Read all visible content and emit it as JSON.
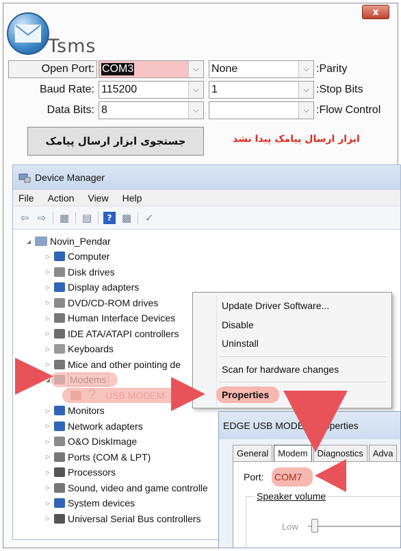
{
  "app": {
    "title": "Tsms",
    "close_glyph": "x"
  },
  "form": {
    "open_port_label": "Open Port:",
    "open_port_value": "COM3",
    "baud_rate_label": "Baud Rate:",
    "baud_rate_value": "115200",
    "data_bits_label": "Data Bits:",
    "data_bits_value": "8",
    "parity_label": ":Parity",
    "parity_value": "None",
    "stop_bits_label": ":Stop Bits",
    "stop_bits_value": "1",
    "flow_control_label": ":Flow Control",
    "flow_control_value": "",
    "search_button_label": "جستجوی ابزار ارسال پیامک",
    "status_text": "ابزار ارسال پیامک پیدا نشد"
  },
  "device_manager": {
    "title": "Device Manager",
    "menu": [
      "File",
      "Action",
      "View",
      "Help"
    ],
    "root": "Novin_Pendar",
    "tree": [
      {
        "label": "Computer",
        "icon": "computer-icon",
        "color": "#2f66b7"
      },
      {
        "label": "Disk drives",
        "icon": "disk-icon",
        "color": "#8a8a8a"
      },
      {
        "label": "Display adapters",
        "icon": "display-icon",
        "color": "#2f66b7"
      },
      {
        "label": "DVD/CD-ROM drives",
        "icon": "dvd-icon",
        "color": "#8a8a8a"
      },
      {
        "label": "Human Interface Devices",
        "icon": "hid-icon",
        "color": "#777777"
      },
      {
        "label": "IDE ATA/ATAPI controllers",
        "icon": "ide-icon",
        "color": "#6d6d6d"
      },
      {
        "label": "Keyboards",
        "icon": "keyboard-icon",
        "color": "#9a9a9a"
      },
      {
        "label": "Mice and other pointing de",
        "icon": "mouse-icon",
        "color": "#777777"
      },
      {
        "label": "Modems",
        "icon": "modem-icon",
        "color": "#6d7d95"
      },
      {
        "label": "USB MODEM",
        "icon": "unknown-device-icon",
        "color": "#b05050"
      },
      {
        "label": "Monitors",
        "icon": "monitor-icon",
        "color": "#2f66b7"
      },
      {
        "label": "Network adapters",
        "icon": "network-icon",
        "color": "#2f66b7"
      },
      {
        "label": "O&O DiskImage",
        "icon": "diskimage-icon",
        "color": "#8a8a8a"
      },
      {
        "label": "Ports (COM & LPT)",
        "icon": "ports-icon",
        "color": "#777777"
      },
      {
        "label": "Processors",
        "icon": "processor-icon",
        "color": "#555555"
      },
      {
        "label": "Sound, video and game controlle",
        "icon": "sound-icon",
        "color": "#777777"
      },
      {
        "label": "System devices",
        "icon": "system-icon",
        "color": "#2f66b7"
      },
      {
        "label": "Universal Serial Bus controllers",
        "icon": "usb-icon",
        "color": "#555555"
      }
    ],
    "unknown_glyph": "?"
  },
  "context_menu": {
    "items": [
      "Update Driver Software...",
      "Disable",
      "Uninstall",
      "Scan for hardware changes",
      "Properties"
    ]
  },
  "properties": {
    "title": "EDGE USB MODEM Properties",
    "tabs": [
      "General",
      "Modem",
      "Diagnostics",
      "Adva"
    ],
    "port_label": "Port:",
    "port_value": "COM7",
    "speaker_volume_label": "Speaker volume",
    "slider_label": "Low"
  },
  "colors": {
    "highlight": "#f7b8b0",
    "arrow": "#e8535a",
    "status_red": "#e02a1f"
  }
}
